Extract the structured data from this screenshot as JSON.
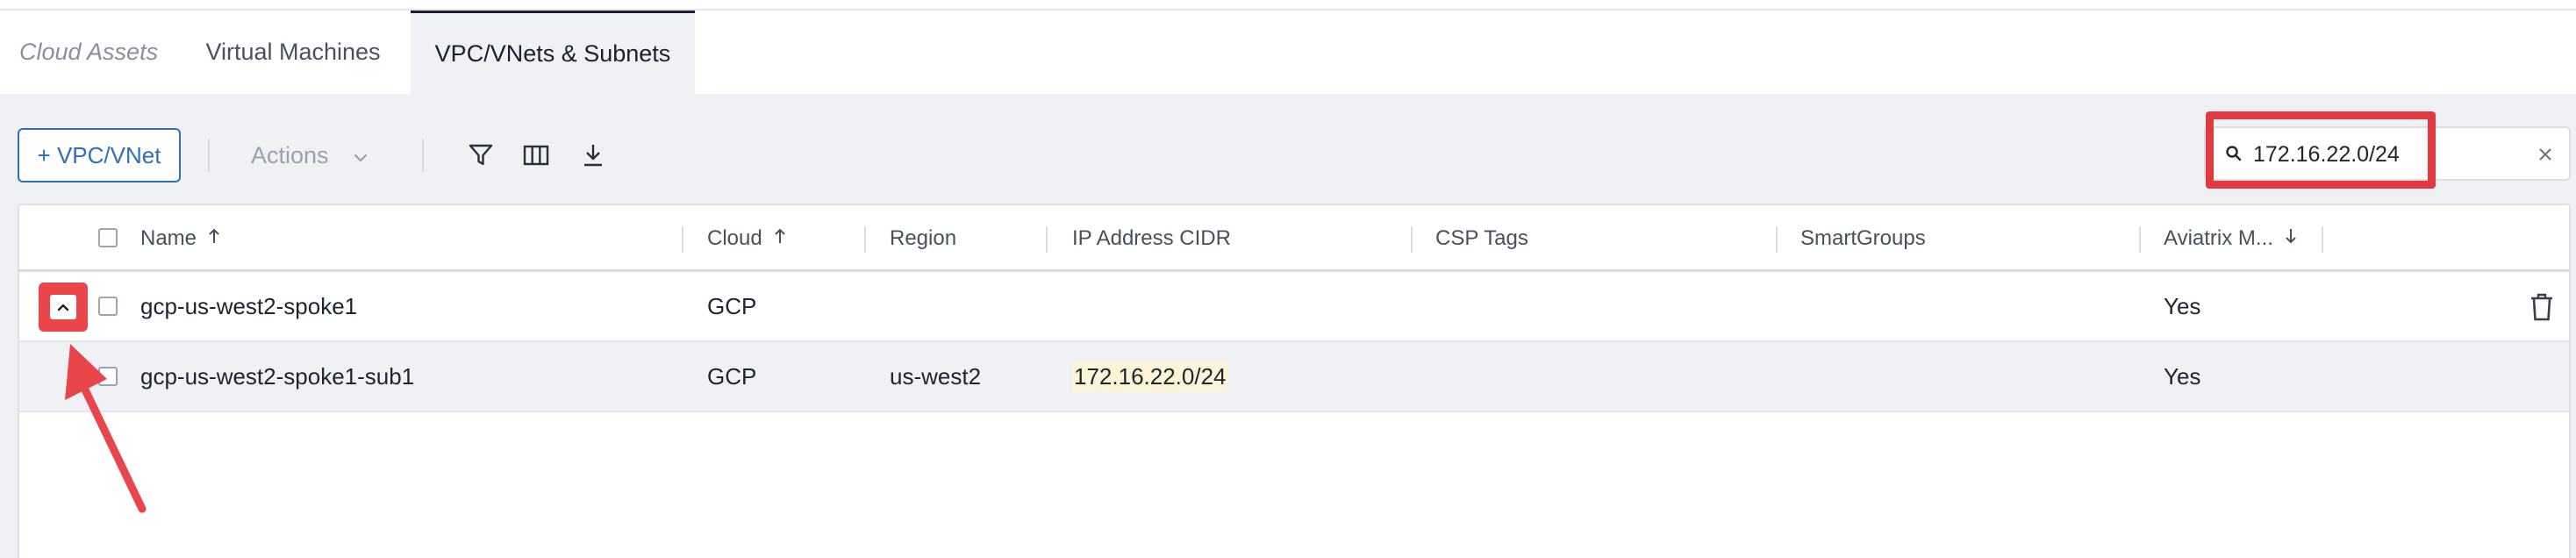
{
  "tabs": [
    {
      "label": "Cloud Assets"
    },
    {
      "label": "Virtual Machines"
    },
    {
      "label": "VPC/VNets & Subnets"
    }
  ],
  "toolbar": {
    "add_label": "+ VPC/VNet",
    "actions_label": "Actions",
    "filter_icon": "filter-icon",
    "columns_icon": "columns-icon",
    "download_icon": "download-icon"
  },
  "search": {
    "value": "172.16.22.0/24",
    "search_icon": "search-icon",
    "clear_icon": "close-icon"
  },
  "table": {
    "columns": [
      {
        "label": "Name",
        "sort": "asc"
      },
      {
        "label": "Cloud",
        "sort": "asc"
      },
      {
        "label": "Region"
      },
      {
        "label": "IP Address CIDR"
      },
      {
        "label": "CSP Tags"
      },
      {
        "label": "SmartGroups"
      },
      {
        "label": "Aviatrix M...",
        "sort": "desc"
      }
    ],
    "rows": [
      {
        "name": "gcp-us-west2-spoke1",
        "cloud": "GCP",
        "region": "",
        "cidr": "",
        "csp_tags": "",
        "smartgroups": "",
        "aviatrix": "Yes",
        "expanded": true
      },
      {
        "name": "gcp-us-west2-spoke1-sub1",
        "cloud": "GCP",
        "region": "us-west2",
        "cidr": "172.16.22.0/24",
        "csp_tags": "",
        "smartgroups": "",
        "aviatrix": "Yes"
      }
    ]
  },
  "colors": {
    "accent": "#2e6fb8",
    "annotation_red": "#e0393e",
    "cidr_highlight": "#fdf3d7",
    "tab_active_bg": "#f0f1f5"
  }
}
